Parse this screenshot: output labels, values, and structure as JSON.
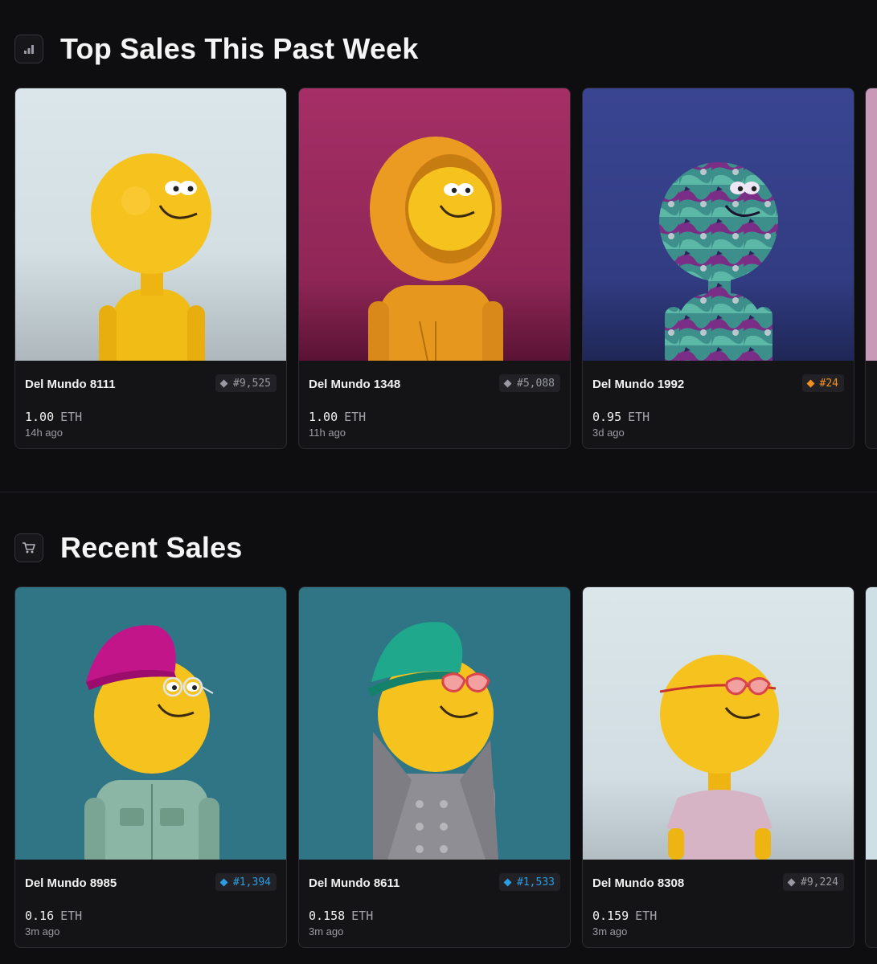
{
  "top_sales": {
    "title": "Top Sales This Past Week",
    "icon": "bar-chart-icon",
    "cards": [
      {
        "name": "Del Mundo 8111",
        "rank": "#9,525",
        "rank_tier": "gray",
        "price": "1.00",
        "currency": "ETH",
        "time": "14h ago",
        "bg": "#d7e2e6",
        "figure": "yellow-plain"
      },
      {
        "name": "Del Mundo 1348",
        "rank": "#5,088",
        "rank_tier": "gray",
        "price": "1.00",
        "currency": "ETH",
        "time": "11h ago",
        "bg": "#a02e63",
        "figure": "orange-hoodie"
      },
      {
        "name": "Del Mundo 1992",
        "rank": "#24",
        "rank_tier": "gold",
        "price": "0.95",
        "currency": "ETH",
        "time": "3d ago",
        "bg": "#343f88",
        "figure": "camo-pattern"
      }
    ],
    "peek_bg": "#c99ab8"
  },
  "recent_sales": {
    "title": "Recent Sales",
    "icon": "shopping-cart-icon",
    "cards": [
      {
        "name": "Del Mundo 8985",
        "rank": "#1,394",
        "rank_tier": "blue",
        "price": "0.16",
        "currency": "ETH",
        "time": "3m ago",
        "bg": "#2f7585",
        "figure": "magenta-cap-glasses-jacket"
      },
      {
        "name": "Del Mundo 8611",
        "rank": "#1,533",
        "rank_tier": "blue",
        "price": "0.158",
        "currency": "ETH",
        "time": "3m ago",
        "bg": "#2f7585",
        "figure": "green-cap-heart-glasses-coat"
      },
      {
        "name": "Del Mundo 8308",
        "rank": "#9,224",
        "rank_tier": "gray",
        "price": "0.159",
        "currency": "ETH",
        "time": "3m ago",
        "bg": "#d7e2e6",
        "figure": "heart-glasses-tshirt"
      }
    ],
    "peek_bg": "#cfdfe6"
  }
}
